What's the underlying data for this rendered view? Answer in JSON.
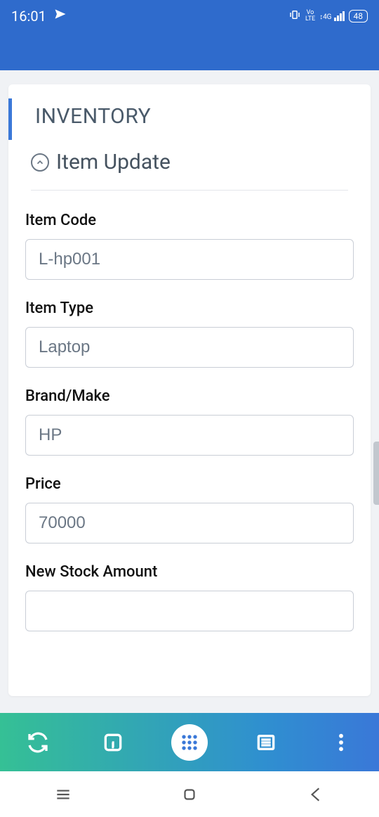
{
  "status": {
    "time": "16:01",
    "battery": "48",
    "net_top": "Vo",
    "net_bot": "LTE",
    "sig": "4G"
  },
  "header": {},
  "card": {
    "title": "INVENTORY"
  },
  "section": {
    "title": "Item Update"
  },
  "fields": {
    "item_code": {
      "label": "Item Code",
      "value": "L-hp001"
    },
    "item_type": {
      "label": "Item Type",
      "value": "Laptop"
    },
    "brand": {
      "label": "Brand/Make",
      "value": "HP"
    },
    "price": {
      "label": "Price",
      "value": "70000"
    },
    "new_stock": {
      "label": "New Stock Amount",
      "value": ""
    }
  },
  "bottombar": {
    "sync": "sync",
    "info": "info",
    "home": "apps",
    "list": "list",
    "more": "more"
  }
}
